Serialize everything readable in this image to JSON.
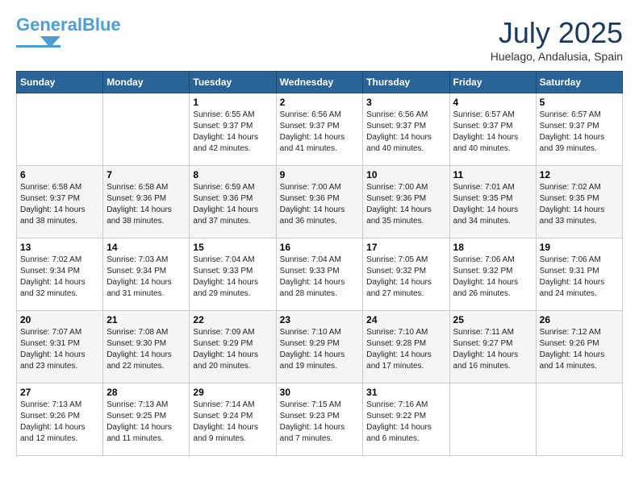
{
  "header": {
    "logo_line1": "General",
    "logo_line2": "Blue",
    "month_year": "July 2025",
    "location": "Huelago, Andalusia, Spain"
  },
  "days_of_week": [
    "Sunday",
    "Monday",
    "Tuesday",
    "Wednesday",
    "Thursday",
    "Friday",
    "Saturday"
  ],
  "weeks": [
    [
      {
        "day": "",
        "info": ""
      },
      {
        "day": "",
        "info": ""
      },
      {
        "day": "1",
        "info": "Sunrise: 6:55 AM\nSunset: 9:37 PM\nDaylight: 14 hours and 42 minutes."
      },
      {
        "day": "2",
        "info": "Sunrise: 6:56 AM\nSunset: 9:37 PM\nDaylight: 14 hours and 41 minutes."
      },
      {
        "day": "3",
        "info": "Sunrise: 6:56 AM\nSunset: 9:37 PM\nDaylight: 14 hours and 40 minutes."
      },
      {
        "day": "4",
        "info": "Sunrise: 6:57 AM\nSunset: 9:37 PM\nDaylight: 14 hours and 40 minutes."
      },
      {
        "day": "5",
        "info": "Sunrise: 6:57 AM\nSunset: 9:37 PM\nDaylight: 14 hours and 39 minutes."
      }
    ],
    [
      {
        "day": "6",
        "info": "Sunrise: 6:58 AM\nSunset: 9:37 PM\nDaylight: 14 hours and 38 minutes."
      },
      {
        "day": "7",
        "info": "Sunrise: 6:58 AM\nSunset: 9:36 PM\nDaylight: 14 hours and 38 minutes."
      },
      {
        "day": "8",
        "info": "Sunrise: 6:59 AM\nSunset: 9:36 PM\nDaylight: 14 hours and 37 minutes."
      },
      {
        "day": "9",
        "info": "Sunrise: 7:00 AM\nSunset: 9:36 PM\nDaylight: 14 hours and 36 minutes."
      },
      {
        "day": "10",
        "info": "Sunrise: 7:00 AM\nSunset: 9:36 PM\nDaylight: 14 hours and 35 minutes."
      },
      {
        "day": "11",
        "info": "Sunrise: 7:01 AM\nSunset: 9:35 PM\nDaylight: 14 hours and 34 minutes."
      },
      {
        "day": "12",
        "info": "Sunrise: 7:02 AM\nSunset: 9:35 PM\nDaylight: 14 hours and 33 minutes."
      }
    ],
    [
      {
        "day": "13",
        "info": "Sunrise: 7:02 AM\nSunset: 9:34 PM\nDaylight: 14 hours and 32 minutes."
      },
      {
        "day": "14",
        "info": "Sunrise: 7:03 AM\nSunset: 9:34 PM\nDaylight: 14 hours and 31 minutes."
      },
      {
        "day": "15",
        "info": "Sunrise: 7:04 AM\nSunset: 9:33 PM\nDaylight: 14 hours and 29 minutes."
      },
      {
        "day": "16",
        "info": "Sunrise: 7:04 AM\nSunset: 9:33 PM\nDaylight: 14 hours and 28 minutes."
      },
      {
        "day": "17",
        "info": "Sunrise: 7:05 AM\nSunset: 9:32 PM\nDaylight: 14 hours and 27 minutes."
      },
      {
        "day": "18",
        "info": "Sunrise: 7:06 AM\nSunset: 9:32 PM\nDaylight: 14 hours and 26 minutes."
      },
      {
        "day": "19",
        "info": "Sunrise: 7:06 AM\nSunset: 9:31 PM\nDaylight: 14 hours and 24 minutes."
      }
    ],
    [
      {
        "day": "20",
        "info": "Sunrise: 7:07 AM\nSunset: 9:31 PM\nDaylight: 14 hours and 23 minutes."
      },
      {
        "day": "21",
        "info": "Sunrise: 7:08 AM\nSunset: 9:30 PM\nDaylight: 14 hours and 22 minutes."
      },
      {
        "day": "22",
        "info": "Sunrise: 7:09 AM\nSunset: 9:29 PM\nDaylight: 14 hours and 20 minutes."
      },
      {
        "day": "23",
        "info": "Sunrise: 7:10 AM\nSunset: 9:29 PM\nDaylight: 14 hours and 19 minutes."
      },
      {
        "day": "24",
        "info": "Sunrise: 7:10 AM\nSunset: 9:28 PM\nDaylight: 14 hours and 17 minutes."
      },
      {
        "day": "25",
        "info": "Sunrise: 7:11 AM\nSunset: 9:27 PM\nDaylight: 14 hours and 16 minutes."
      },
      {
        "day": "26",
        "info": "Sunrise: 7:12 AM\nSunset: 9:26 PM\nDaylight: 14 hours and 14 minutes."
      }
    ],
    [
      {
        "day": "27",
        "info": "Sunrise: 7:13 AM\nSunset: 9:26 PM\nDaylight: 14 hours and 12 minutes."
      },
      {
        "day": "28",
        "info": "Sunrise: 7:13 AM\nSunset: 9:25 PM\nDaylight: 14 hours and 11 minutes."
      },
      {
        "day": "29",
        "info": "Sunrise: 7:14 AM\nSunset: 9:24 PM\nDaylight: 14 hours and 9 minutes."
      },
      {
        "day": "30",
        "info": "Sunrise: 7:15 AM\nSunset: 9:23 PM\nDaylight: 14 hours and 7 minutes."
      },
      {
        "day": "31",
        "info": "Sunrise: 7:16 AM\nSunset: 9:22 PM\nDaylight: 14 hours and 6 minutes."
      },
      {
        "day": "",
        "info": ""
      },
      {
        "day": "",
        "info": ""
      }
    ]
  ]
}
